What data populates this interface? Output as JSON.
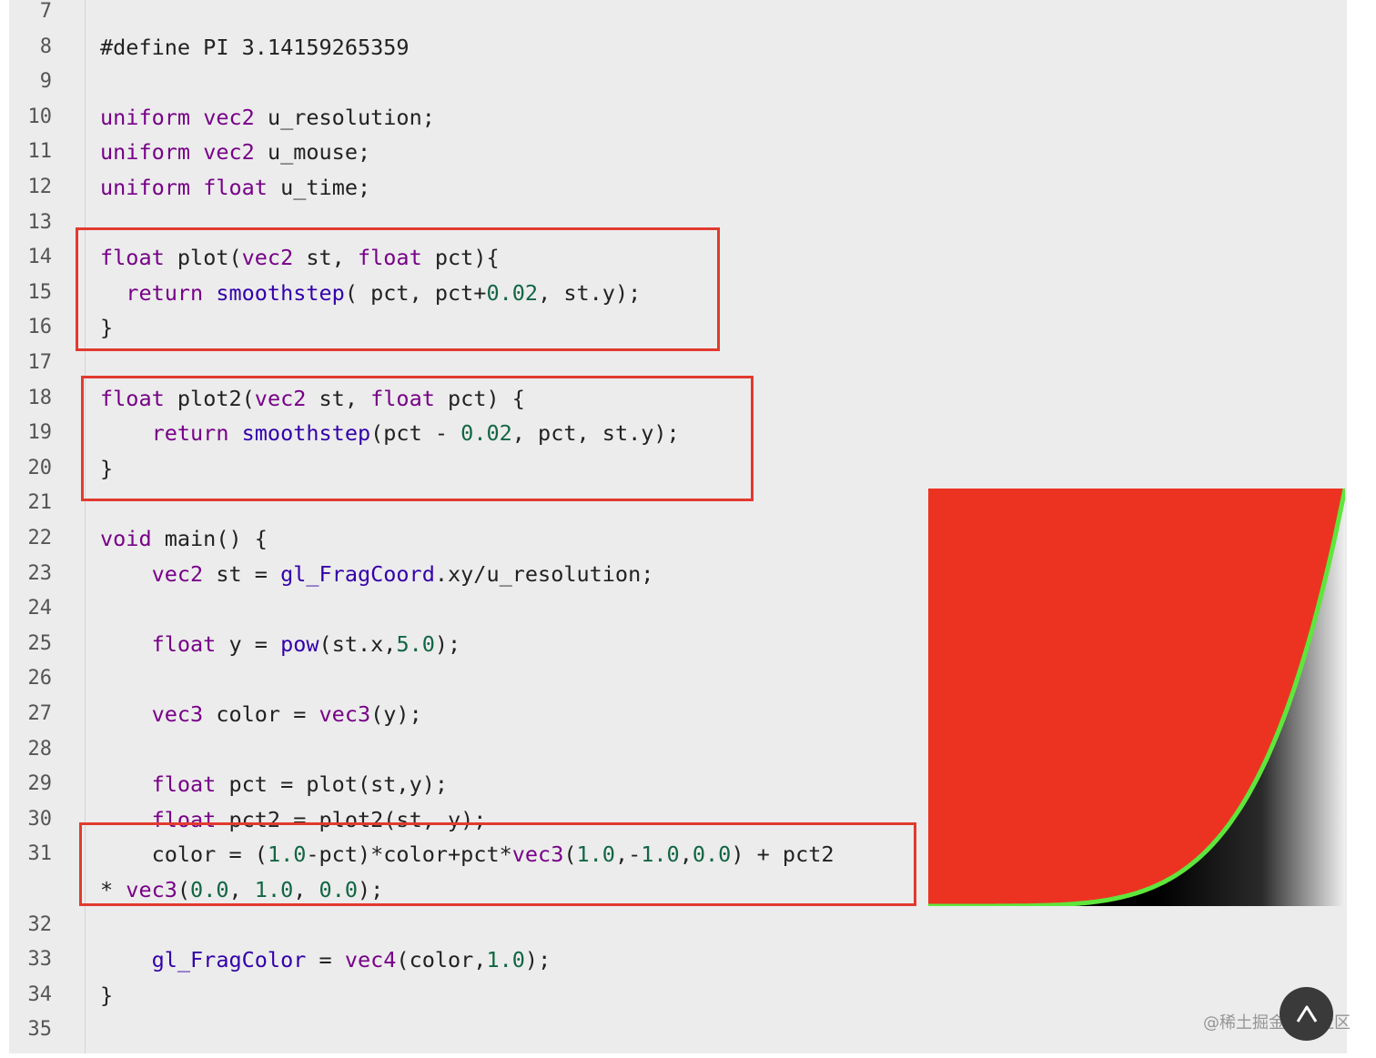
{
  "line_numbers": [
    "7",
    "8",
    "9",
    "10",
    "11",
    "12",
    "13",
    "14",
    "15",
    "16",
    "17",
    "18",
    "19",
    "20",
    "21",
    "22",
    "23",
    "24",
    "25",
    "26",
    "27",
    "28",
    "29",
    "30",
    "31",
    "32",
    "33",
    "34",
    "35"
  ],
  "code": {
    "l8": [
      "#define PI 3.14159265359"
    ],
    "l10": [
      "uniform",
      " ",
      "vec2",
      " u_resolution;"
    ],
    "l11": [
      "uniform",
      " ",
      "vec2",
      " u_mouse;"
    ],
    "l12": [
      "uniform",
      " ",
      "float",
      " u_time;"
    ],
    "l14": [
      "float",
      " plot(",
      "vec2",
      " st, ",
      "float",
      " pct){"
    ],
    "l15": [
      "  ",
      "return",
      " ",
      "smoothstep",
      "( pct, pct+",
      "0.02",
      ", st.y);"
    ],
    "l16": [
      "}"
    ],
    "l18": [
      "float",
      " plot2(",
      "vec2",
      " st, ",
      "float",
      " pct) {"
    ],
    "l19": [
      "    ",
      "return",
      " ",
      "smoothstep",
      "(pct - ",
      "0.02",
      ", pct, st.y);"
    ],
    "l20": [
      "}"
    ],
    "l22": [
      "void",
      " main() {"
    ],
    "l23": [
      "    ",
      "vec2",
      " st = ",
      "gl_FragCoord",
      ".xy/u_resolution;"
    ],
    "l25": [
      "    ",
      "float",
      " y = ",
      "pow",
      "(st.x,",
      "5.0",
      ");"
    ],
    "l27": [
      "    ",
      "vec3",
      " color = ",
      "vec3",
      "(y);"
    ],
    "l29": [
      "    ",
      "float",
      " pct = plot(st,y);"
    ],
    "l30": [
      "    ",
      "float",
      " pct2 = plot2(st, y);"
    ],
    "l31a": [
      "    color = (",
      "1.0",
      "-pct)*color+pct*",
      "vec3",
      "(",
      "1.0",
      ",-",
      "1.0",
      ",",
      "0.0",
      ") + pct2"
    ],
    "l31b": [
      "* ",
      "vec3",
      "(",
      "0.0",
      ", ",
      "1.0",
      ", ",
      "0.0",
      ");"
    ],
    "l33": [
      "    ",
      "gl_FragColor",
      " = ",
      "vec4",
      "(color,",
      "1.0",
      ");"
    ],
    "l34": [
      "}"
    ]
  },
  "colors": {
    "keyword": "#770088",
    "builtin": "#3300aa",
    "number": "#116644",
    "highlight_box": "#e23a2f",
    "preview_red": "#ec3322",
    "preview_curve": "#5ee63c"
  },
  "preview": {
    "shader_exponent": 5.0
  },
  "watermark": "@稀土掘金技术社区",
  "icons": {
    "scroll_top": "up-arrow-icon"
  }
}
